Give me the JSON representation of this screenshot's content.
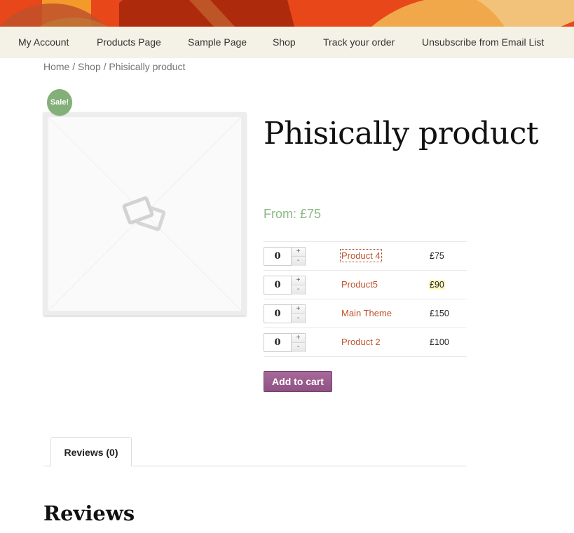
{
  "banner": {
    "colors": [
      "#e8471a",
      "#f39a2b",
      "#ae2a0c",
      "#f0a84a",
      "#f3c27a",
      "#c0512b"
    ]
  },
  "nav": {
    "items": [
      {
        "label": "My Account"
      },
      {
        "label": "Products Page"
      },
      {
        "label": "Sample Page"
      },
      {
        "label": "Shop"
      },
      {
        "label": "Track your order"
      },
      {
        "label": "Unsubscribe from Email List"
      }
    ]
  },
  "breadcrumb": {
    "home": "Home",
    "shop": "Shop",
    "current": "Phisically product",
    "separator": " / "
  },
  "product": {
    "sale_badge": "Sale!",
    "title": "Phisically product",
    "price_from": "From: £75",
    "image_icon": "placeholder-image-icon",
    "grouped_items": [
      {
        "qty": "0",
        "name": "Product 4",
        "price": "£75",
        "focused": true,
        "highlighted": false
      },
      {
        "qty": "0",
        "name": "Product5",
        "price": "£90",
        "focused": false,
        "highlighted": true
      },
      {
        "qty": "0",
        "name": "Main Theme",
        "price": "£150",
        "focused": false,
        "highlighted": false
      },
      {
        "qty": "0",
        "name": "Product 2",
        "price": "£100",
        "focused": false,
        "highlighted": false
      }
    ],
    "stepper_plus": "+",
    "stepper_minus": "-",
    "add_to_cart": "Add to cart"
  },
  "tabs": [
    {
      "label": "Reviews (0)",
      "active": true
    }
  ],
  "reviews": {
    "heading": "Reviews"
  },
  "colors": {
    "nav_bg": "#f4f2e6",
    "link": "#c0532e",
    "price_green": "#8cba85",
    "sale_green": "#83af79",
    "button_purple": "#9b5c8f"
  }
}
